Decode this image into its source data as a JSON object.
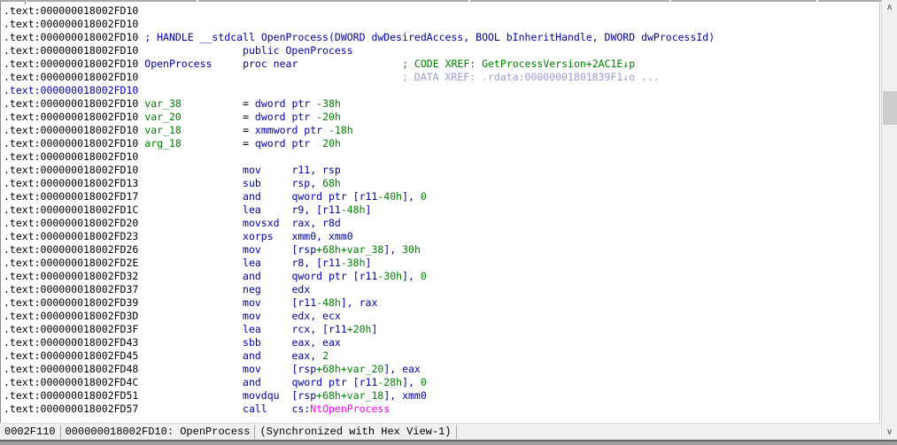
{
  "view": {
    "name": "IDA disassembly view",
    "segment": ".text",
    "function": "OpenProcess"
  },
  "colors": {
    "k": "#000000",
    "b": "#0000aa",
    "g": "#008000",
    "p": "#9b9bdb",
    "m": "#ff00ff",
    "listing_bg": "#ffffff",
    "statusbar_bg": "#f0f0f0",
    "scroll_track": "#f0f0f0",
    "scroll_thumb": "#cdcdcd"
  },
  "listing": {
    "lines": [
      [
        [
          ".text:000000018002FD10",
          "k"
        ]
      ],
      [
        [
          ".text:000000018002FD10",
          "k"
        ]
      ],
      [
        [
          ".text:000000018002FD10",
          "k"
        ],
        [
          1
        ],
        [
          "; HANDLE __stdcall OpenProcess(DWORD dwDesiredAccess, BOOL bInheritHandle, DWORD dwProcessId)",
          "b"
        ]
      ],
      [
        [
          ".text:000000018002FD10",
          "k"
        ],
        [
          17
        ],
        [
          "public OpenProcess",
          "b"
        ]
      ],
      [
        [
          ".text:000000018002FD10",
          "k"
        ],
        [
          1
        ],
        [
          "OpenProcess",
          "b"
        ],
        [
          5
        ],
        [
          "proc near",
          "b"
        ],
        [
          17
        ],
        [
          "; CODE XREF: GetProcessVersion+2AC1E↓p",
          "g"
        ]
      ],
      [
        [
          ".text:000000018002FD10",
          "k"
        ],
        [
          43
        ],
        [
          "; DATA XREF: .rdata:00000001801839F1↓o ...",
          "p"
        ]
      ],
      [
        [
          ".text:000000018002FD10",
          "b"
        ]
      ],
      [
        [
          ".text:000000018002FD10",
          "k"
        ],
        [
          1
        ],
        [
          "var_38",
          "g"
        ],
        [
          10
        ],
        [
          "= ",
          "k"
        ],
        [
          "dword ptr ",
          "b"
        ],
        [
          "-38h",
          "g"
        ]
      ],
      [
        [
          ".text:000000018002FD10",
          "k"
        ],
        [
          1
        ],
        [
          "var_20",
          "g"
        ],
        [
          10
        ],
        [
          "= ",
          "k"
        ],
        [
          "dword ptr ",
          "b"
        ],
        [
          "-20h",
          "g"
        ]
      ],
      [
        [
          ".text:000000018002FD10",
          "k"
        ],
        [
          1
        ],
        [
          "var_18",
          "g"
        ],
        [
          10
        ],
        [
          "= ",
          "k"
        ],
        [
          "xmmword ptr ",
          "b"
        ],
        [
          "-18h",
          "g"
        ]
      ],
      [
        [
          ".text:000000018002FD10",
          "k"
        ],
        [
          1
        ],
        [
          "arg_18",
          "g"
        ],
        [
          10
        ],
        [
          "= ",
          "k"
        ],
        [
          "qword ptr  ",
          "b"
        ],
        [
          "20h",
          "g"
        ]
      ],
      [
        [
          ".text:000000018002FD10",
          "k"
        ]
      ],
      [
        [
          ".text:000000018002FD10",
          "k"
        ],
        [
          17
        ],
        [
          "mov",
          "b"
        ],
        [
          5
        ],
        [
          "r11, rsp",
          "b"
        ]
      ],
      [
        [
          ".text:000000018002FD13",
          "k"
        ],
        [
          17
        ],
        [
          "sub",
          "b"
        ],
        [
          5
        ],
        [
          "rsp, ",
          "b"
        ],
        [
          "68h",
          "g"
        ]
      ],
      [
        [
          ".text:000000018002FD17",
          "k"
        ],
        [
          17
        ],
        [
          "and",
          "b"
        ],
        [
          5
        ],
        [
          "qword ptr [r11",
          "b"
        ],
        [
          "-40h",
          "g"
        ],
        [
          "], ",
          "b"
        ],
        [
          "0",
          "g"
        ]
      ],
      [
        [
          ".text:000000018002FD1C",
          "k"
        ],
        [
          17
        ],
        [
          "lea",
          "b"
        ],
        [
          5
        ],
        [
          "r9, [r11",
          "b"
        ],
        [
          "-48h",
          "g"
        ],
        [
          "]",
          "b"
        ]
      ],
      [
        [
          ".text:000000018002FD20",
          "k"
        ],
        [
          17
        ],
        [
          "movsxd",
          "b"
        ],
        [
          2
        ],
        [
          "rax, r8d",
          "b"
        ]
      ],
      [
        [
          ".text:000000018002FD23",
          "k"
        ],
        [
          17
        ],
        [
          "xorps",
          "b"
        ],
        [
          3
        ],
        [
          "xmm0, xmm0",
          "b"
        ]
      ],
      [
        [
          ".text:000000018002FD26",
          "k"
        ],
        [
          17
        ],
        [
          "mov",
          "b"
        ],
        [
          5
        ],
        [
          "[rsp",
          "b"
        ],
        [
          "+68h+var_38",
          "g"
        ],
        [
          "], ",
          "b"
        ],
        [
          "30h",
          "g"
        ]
      ],
      [
        [
          ".text:000000018002FD2E",
          "k"
        ],
        [
          17
        ],
        [
          "lea",
          "b"
        ],
        [
          5
        ],
        [
          "r8, [r11",
          "b"
        ],
        [
          "-38h",
          "g"
        ],
        [
          "]",
          "b"
        ]
      ],
      [
        [
          ".text:000000018002FD32",
          "k"
        ],
        [
          17
        ],
        [
          "and",
          "b"
        ],
        [
          5
        ],
        [
          "qword ptr [r11",
          "b"
        ],
        [
          "-30h",
          "g"
        ],
        [
          "], ",
          "b"
        ],
        [
          "0",
          "g"
        ]
      ],
      [
        [
          ".text:000000018002FD37",
          "k"
        ],
        [
          17
        ],
        [
          "neg",
          "b"
        ],
        [
          5
        ],
        [
          "edx",
          "b"
        ]
      ],
      [
        [
          ".text:000000018002FD39",
          "k"
        ],
        [
          17
        ],
        [
          "mov",
          "b"
        ],
        [
          5
        ],
        [
          "[r11",
          "b"
        ],
        [
          "-48h",
          "g"
        ],
        [
          "], rax",
          "b"
        ]
      ],
      [
        [
          ".text:000000018002FD3D",
          "k"
        ],
        [
          17
        ],
        [
          "mov",
          "b"
        ],
        [
          5
        ],
        [
          "edx, ecx",
          "b"
        ]
      ],
      [
        [
          ".text:000000018002FD3F",
          "k"
        ],
        [
          17
        ],
        [
          "lea",
          "b"
        ],
        [
          5
        ],
        [
          "rcx, [r11",
          "b"
        ],
        [
          "+20h",
          "g"
        ],
        [
          "]",
          "b"
        ]
      ],
      [
        [
          ".text:000000018002FD43",
          "k"
        ],
        [
          17
        ],
        [
          "sbb",
          "b"
        ],
        [
          5
        ],
        [
          "eax, eax",
          "b"
        ]
      ],
      [
        [
          ".text:000000018002FD45",
          "k"
        ],
        [
          17
        ],
        [
          "and",
          "b"
        ],
        [
          5
        ],
        [
          "eax, ",
          "b"
        ],
        [
          "2",
          "g"
        ]
      ],
      [
        [
          ".text:000000018002FD48",
          "k"
        ],
        [
          17
        ],
        [
          "mov",
          "b"
        ],
        [
          5
        ],
        [
          "[rsp",
          "b"
        ],
        [
          "+68h+var_20",
          "g"
        ],
        [
          "], eax",
          "b"
        ]
      ],
      [
        [
          ".text:000000018002FD4C",
          "k"
        ],
        [
          17
        ],
        [
          "and",
          "b"
        ],
        [
          5
        ],
        [
          "qword ptr [r11",
          "b"
        ],
        [
          "-28h",
          "g"
        ],
        [
          "], ",
          "b"
        ],
        [
          "0",
          "g"
        ]
      ],
      [
        [
          ".text:000000018002FD51",
          "k"
        ],
        [
          17
        ],
        [
          "movdqu",
          "b"
        ],
        [
          2
        ],
        [
          "[rsp",
          "b"
        ],
        [
          "+68h+var_18",
          "g"
        ],
        [
          "], xmm0",
          "b"
        ]
      ],
      [
        [
          ".text:000000018002FD57",
          "k"
        ],
        [
          17
        ],
        [
          "call",
          "b"
        ],
        [
          4
        ],
        [
          "cs:",
          "b"
        ],
        [
          "NtOpenProcess",
          "m"
        ]
      ]
    ]
  },
  "status_bar": {
    "cells": [
      "0002F110",
      "000000018002FD10: OpenProcess",
      "(Synchronized with Hex View-1)"
    ]
  },
  "scrollbar": {
    "up_icon": "∧",
    "down_icon": "∨"
  }
}
